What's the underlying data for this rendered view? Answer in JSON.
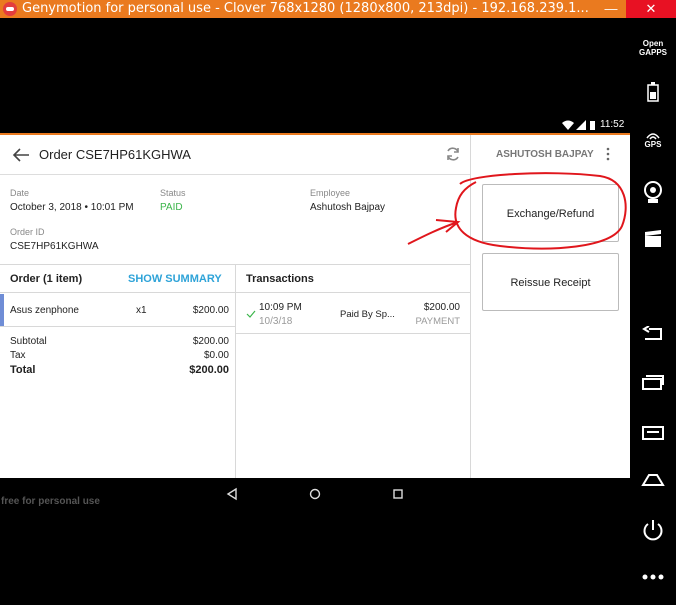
{
  "window": {
    "title": "Genymotion for personal use - Clover 768x1280 (1280x800, 213dpi) - 192.168.239.1...",
    "minimize": "—",
    "close": "✕"
  },
  "sidebar": {
    "open_gapps": "Open\nGAPPS",
    "gps": "GPS"
  },
  "statusbar": {
    "time": "11:52"
  },
  "header": {
    "order_title": "Order CSE7HP61KGHWA",
    "user": "ASHUTOSH BAJPAY"
  },
  "details": {
    "date_label": "Date",
    "date_value": "October 3, 2018 • 10:01 PM",
    "status_label": "Status",
    "status_value": "PAID",
    "employee_label": "Employee",
    "employee_value": "Ashutosh Bajpay",
    "order_id_label": "Order ID",
    "order_id_value": "CSE7HP61KGHWA"
  },
  "order": {
    "title": "Order (1 item)",
    "show_summary": "SHOW SUMMARY",
    "items": [
      {
        "name": "Asus zenphone",
        "qty": "x1",
        "price": "$200.00"
      }
    ],
    "subtotal_label": "Subtotal",
    "subtotal_value": "$200.00",
    "tax_label": "Tax",
    "tax_value": "$0.00",
    "total_label": "Total",
    "total_value": "$200.00"
  },
  "transactions": {
    "title": "Transactions",
    "rows": [
      {
        "time": "10:09 PM",
        "date": "10/3/18",
        "by": "Paid By Sp...",
        "amount": "$200.00",
        "type": "PAYMENT"
      }
    ]
  },
  "actions": {
    "exchange_refund": "Exchange/Refund",
    "reissue_receipt": "Reissue Receipt"
  },
  "watermark": "free for personal use",
  "colors": {
    "accent": "#ea7a1f",
    "paid": "#3bb54a",
    "link": "#2ea3d8",
    "annotation": "#e0161c"
  }
}
